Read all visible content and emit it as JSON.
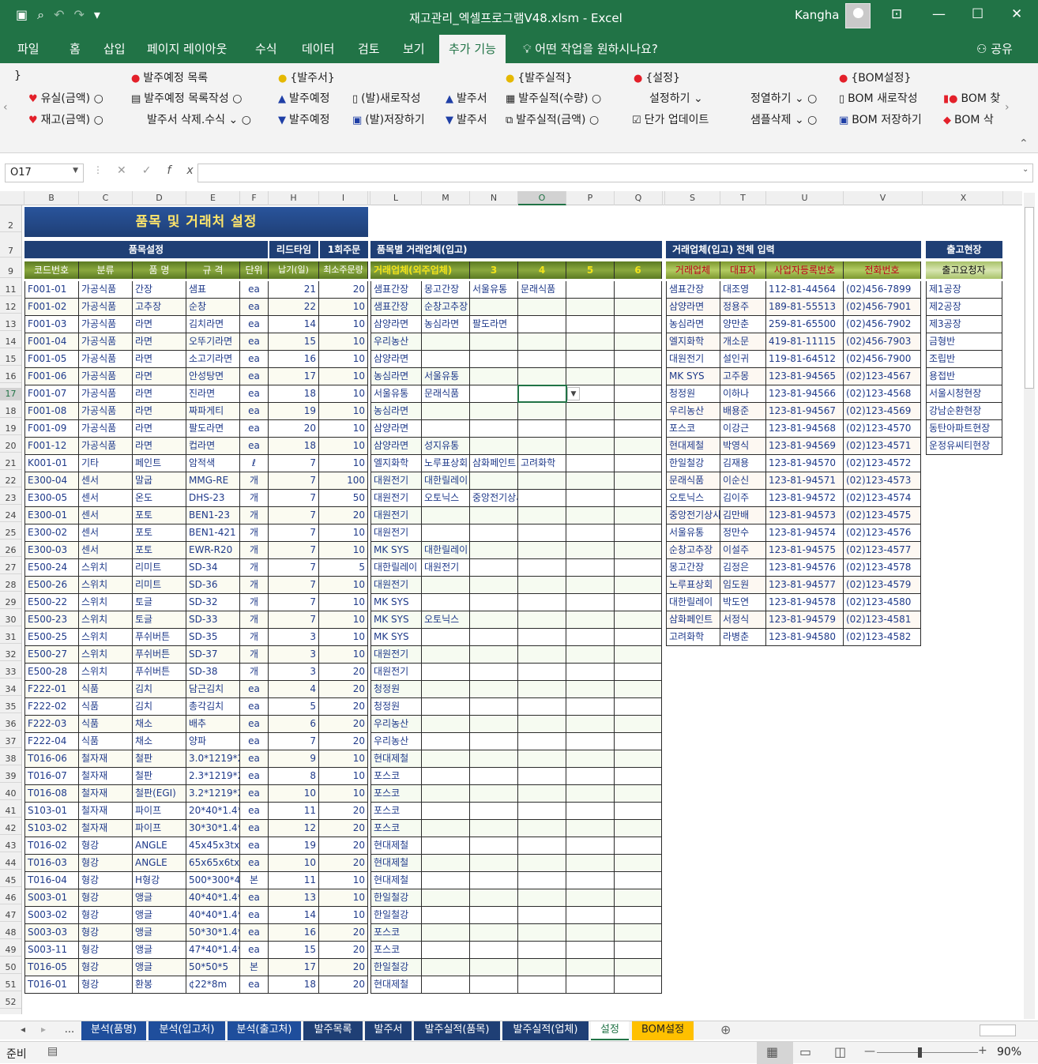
{
  "window": {
    "title": "재고관리_엑셀프로그램V48.xlsm  -  Excel",
    "user": "Kangha"
  },
  "tabs": [
    "파일",
    "홈",
    "삽입",
    "페이지 레이아웃",
    "수식",
    "데이터",
    "검토",
    "보기",
    "추가 기능"
  ],
  "active_tab": "추가 기능",
  "tellme": "어떤 작업을 원하시나요?",
  "share": "공유",
  "ribbon": {
    "g1": {
      "top": "}",
      "a": "유실(금액)",
      "b": "재고(금액)"
    },
    "g2": {
      "top": "발주예정 목록",
      "a": "발주예정 목록작성",
      "b": "발주서 삭제.수식"
    },
    "g3": {
      "top": "{발주서}",
      "a": "발주예정",
      "b": "발주예정",
      "c": "(발)새로작성",
      "d": "(발)저장하기",
      "e": "발주서",
      "f": "발주서"
    },
    "g4": {
      "top": "{발주실적}",
      "a": "발주실적(수량)",
      "b": "발주실적(금액)"
    },
    "g5": {
      "top": "{설정}",
      "a": "설정하기",
      "b": "단가 업데이트",
      "c": "정열하기",
      "d": "샘플삭제"
    },
    "g6": {
      "top": "{BOM설정}",
      "a": "BOM 새로작성",
      "b": "BOM 저장하기",
      "c": "BOM 찾",
      "d": "BOM 삭"
    }
  },
  "formula": {
    "name_box": "O17"
  },
  "columns": [
    "A",
    "B",
    "C",
    "D",
    "E",
    "F",
    "H",
    "I",
    "K",
    "L",
    "M",
    "N",
    "O",
    "P",
    "Q",
    "R",
    "S",
    "T",
    "U",
    "V",
    "X"
  ],
  "selected_col": "O",
  "rows": [
    "2",
    "7",
    "9",
    "11",
    "12",
    "13",
    "14",
    "15",
    "16",
    "17",
    "18",
    "19",
    "20",
    "21",
    "22",
    "23",
    "24",
    "25",
    "26",
    "27",
    "28",
    "29",
    "30",
    "31",
    "32",
    "33",
    "34",
    "35",
    "36",
    "37",
    "38",
    "39",
    "40",
    "41",
    "42",
    "43",
    "44",
    "45",
    "46",
    "47",
    "48",
    "49",
    "50",
    "51",
    "52"
  ],
  "selected_row": "17",
  "sheet": {
    "banner": "품목 및 거래처 설정",
    "sec1": "품목설정",
    "sec1b": "리드타임",
    "sec1c": "1회주문",
    "sec2": "품목별 거래업체(입고)",
    "sec3": "거래업체(입고) 전체 입력",
    "sec4": "출고현장",
    "hdr1": [
      "코드번호",
      "분류",
      "품 명",
      "규 격",
      "단위",
      "납기(일)",
      "최소주문량"
    ],
    "hdr2": [
      "거래업체(외주업체)",
      "3",
      "4",
      "5",
      "6"
    ],
    "hdr3": [
      "거래업체",
      "대표자",
      "사업자등록번호",
      "전화번호"
    ],
    "hdr4": "출고요청자",
    "items": [
      [
        "F001-01",
        "가공식품",
        "간장",
        "샘표",
        "ea",
        "21",
        "20"
      ],
      [
        "F001-02",
        "가공식품",
        "고추장",
        "순창",
        "ea",
        "22",
        "10"
      ],
      [
        "F001-03",
        "가공식품",
        "라면",
        "김치라면",
        "ea",
        "14",
        "10"
      ],
      [
        "F001-04",
        "가공식품",
        "라면",
        "오뚜기라면",
        "ea",
        "15",
        "10"
      ],
      [
        "F001-05",
        "가공식품",
        "라면",
        "소고기라면",
        "ea",
        "16",
        "10"
      ],
      [
        "F001-06",
        "가공식품",
        "라면",
        "안성탕면",
        "ea",
        "17",
        "10"
      ],
      [
        "F001-07",
        "가공식품",
        "라면",
        "진라면",
        "ea",
        "18",
        "10"
      ],
      [
        "F001-08",
        "가공식품",
        "라면",
        "짜파게티",
        "ea",
        "19",
        "10"
      ],
      [
        "F001-09",
        "가공식품",
        "라면",
        "팔도라면",
        "ea",
        "20",
        "10"
      ],
      [
        "F001-12",
        "가공식품",
        "라면",
        "컵라면",
        "ea",
        "18",
        "10"
      ],
      [
        "K001-01",
        "기타",
        "페인트",
        "암적색",
        "ℓ",
        "7",
        "10"
      ],
      [
        "E300-04",
        "센서",
        "말굽",
        "MMG-RE",
        "개",
        "7",
        "100"
      ],
      [
        "E300-05",
        "센서",
        "온도",
        "DHS-23",
        "개",
        "7",
        "50"
      ],
      [
        "E300-01",
        "센서",
        "포토",
        "BEN1-23",
        "개",
        "7",
        "20"
      ],
      [
        "E300-02",
        "센서",
        "포토",
        "BEN1-421",
        "개",
        "7",
        "10"
      ],
      [
        "E300-03",
        "센서",
        "포토",
        "EWR-R20",
        "개",
        "7",
        "10"
      ],
      [
        "E500-24",
        "스위치",
        "리미트",
        "SD-34",
        "개",
        "7",
        "5"
      ],
      [
        "E500-26",
        "스위치",
        "리미트",
        "SD-36",
        "개",
        "7",
        "10"
      ],
      [
        "E500-22",
        "스위치",
        "토글",
        "SD-32",
        "개",
        "7",
        "10"
      ],
      [
        "E500-23",
        "스위치",
        "토글",
        "SD-33",
        "개",
        "7",
        "10"
      ],
      [
        "E500-25",
        "스위치",
        "푸쉬버튼",
        "SD-35",
        "개",
        "3",
        "10"
      ],
      [
        "E500-27",
        "스위치",
        "푸쉬버튼",
        "SD-37",
        "개",
        "3",
        "10"
      ],
      [
        "E500-28",
        "스위치",
        "푸쉬버튼",
        "SD-38",
        "개",
        "3",
        "20"
      ],
      [
        "F222-01",
        "식품",
        "김치",
        "담근김치",
        "ea",
        "4",
        "20"
      ],
      [
        "F222-02",
        "식품",
        "김치",
        "총각김치",
        "ea",
        "5",
        "20"
      ],
      [
        "F222-03",
        "식품",
        "채소",
        "배추",
        "ea",
        "6",
        "20"
      ],
      [
        "F222-04",
        "식품",
        "채소",
        "양파",
        "ea",
        "7",
        "20"
      ],
      [
        "T016-06",
        "철자재",
        "철판",
        "3.0*1219*24",
        "ea",
        "9",
        "10"
      ],
      [
        "T016-07",
        "철자재",
        "철판",
        "2.3*1219*24",
        "ea",
        "8",
        "10"
      ],
      [
        "T016-08",
        "철자재",
        "철판(EGI)",
        "3.2*1219*24",
        "ea",
        "10",
        "10"
      ],
      [
        "S103-01",
        "철자재",
        "파이프",
        "20*40*1.4*6",
        "ea",
        "11",
        "20"
      ],
      [
        "S103-02",
        "철자재",
        "파이프",
        "30*30*1.4*6",
        "ea",
        "12",
        "20"
      ],
      [
        "T016-02",
        "형강",
        "ANGLE",
        "45x45x3tx6",
        "ea",
        "19",
        "20"
      ],
      [
        "T016-03",
        "형강",
        "ANGLE",
        "65x65x6tx1",
        "ea",
        "10",
        "20"
      ],
      [
        "T016-04",
        "형강",
        "H형강",
        "500*300*4*",
        "본",
        "11",
        "10"
      ],
      [
        "S003-01",
        "형강",
        "앵글",
        "40*40*1.4*1",
        "ea",
        "13",
        "10"
      ],
      [
        "S003-02",
        "형강",
        "앵글",
        "40*40*1.4*6",
        "ea",
        "14",
        "10"
      ],
      [
        "S003-03",
        "형강",
        "앵글",
        "50*30*1.4*6",
        "ea",
        "16",
        "20"
      ],
      [
        "S003-11",
        "형강",
        "앵글",
        "47*40*1.4*6",
        "ea",
        "15",
        "20"
      ],
      [
        "T016-05",
        "형강",
        "앵글",
        "50*50*5",
        "본",
        "17",
        "20"
      ],
      [
        "T016-01",
        "형강",
        "환봉",
        "¢22*8m",
        "ea",
        "18",
        "20"
      ]
    ],
    "vendors_by_item": [
      [
        "샘표간장",
        "몽고간장",
        "서울유통",
        "문래식품"
      ],
      [
        "샘표간장",
        "순창고추장",
        "",
        ""
      ],
      [
        "삼양라면",
        "농심라면",
        "팔도라면",
        ""
      ],
      [
        "우리농산",
        "",
        "",
        ""
      ],
      [
        "삼양라면",
        "",
        "",
        ""
      ],
      [
        "농심라면",
        "서울유통",
        "",
        ""
      ],
      [
        "서울유통",
        "문래식품",
        "",
        ""
      ],
      [
        "농심라면",
        "",
        "",
        ""
      ],
      [
        "삼양라면",
        "",
        "",
        ""
      ],
      [
        "삼양라면",
        "성지유통",
        "",
        ""
      ],
      [
        "엘지화학",
        "노루표상회",
        "삼화페인트",
        "고려화학"
      ],
      [
        "대원전기",
        "대한릴레이",
        "",
        ""
      ],
      [
        "대원전기",
        "오토닉스",
        "중앙전기상사",
        ""
      ],
      [
        "대원전기",
        "",
        "",
        ""
      ],
      [
        "대원전기",
        "",
        "",
        ""
      ],
      [
        "MK SYS",
        "대한릴레이",
        "",
        ""
      ],
      [
        "대한릴레이",
        "대원전기",
        "",
        ""
      ],
      [
        "대원전기",
        "",
        "",
        ""
      ],
      [
        "MK SYS",
        "",
        "",
        ""
      ],
      [
        "MK SYS",
        "오토닉스",
        "",
        ""
      ],
      [
        "MK SYS",
        "",
        "",
        ""
      ],
      [
        "대원전기",
        "",
        "",
        ""
      ],
      [
        "대원전기",
        "",
        "",
        ""
      ],
      [
        "청정원",
        "",
        "",
        ""
      ],
      [
        "청정원",
        "",
        "",
        ""
      ],
      [
        "우리농산",
        "",
        "",
        ""
      ],
      [
        "우리농산",
        "",
        "",
        ""
      ],
      [
        "현대제철",
        "",
        "",
        ""
      ],
      [
        "포스코",
        "",
        "",
        ""
      ],
      [
        "포스코",
        "",
        "",
        ""
      ],
      [
        "포스코",
        "",
        "",
        ""
      ],
      [
        "포스코",
        "",
        "",
        ""
      ],
      [
        "현대제철",
        "",
        "",
        ""
      ],
      [
        "현대제철",
        "",
        "",
        ""
      ],
      [
        "현대제철",
        "",
        "",
        ""
      ],
      [
        "한일철강",
        "",
        "",
        ""
      ],
      [
        "한일철강",
        "",
        "",
        ""
      ],
      [
        "포스코",
        "",
        "",
        ""
      ],
      [
        "포스코",
        "",
        "",
        ""
      ],
      [
        "한일철강",
        "",
        "",
        ""
      ],
      [
        "현대제철",
        "",
        "",
        ""
      ]
    ],
    "vendors": [
      [
        "샘표간장",
        "대조영",
        "112-81-44564",
        "(02)456-7899"
      ],
      [
        "삼양라면",
        "정용주",
        "189-81-55513",
        "(02)456-7901"
      ],
      [
        "농심라면",
        "양만춘",
        "259-81-65500",
        "(02)456-7902"
      ],
      [
        "엘지화학",
        "개소문",
        "419-81-11115",
        "(02)456-7903"
      ],
      [
        "대원전기",
        "설인귀",
        "119-81-64512",
        "(02)456-7900"
      ],
      [
        "MK SYS",
        "고주몽",
        "123-81-94565",
        "(02)123-4567"
      ],
      [
        "청정원",
        "이하나",
        "123-81-94566",
        "(02)123-4568"
      ],
      [
        "우리농산",
        "배용준",
        "123-81-94567",
        "(02)123-4569"
      ],
      [
        "포스코",
        "이강근",
        "123-81-94568",
        "(02)123-4570"
      ],
      [
        "현대제철",
        "박영식",
        "123-81-94569",
        "(02)123-4571"
      ],
      [
        "한일철강",
        "김재용",
        "123-81-94570",
        "(02)123-4572"
      ],
      [
        "문래식품",
        "이순신",
        "123-81-94571",
        "(02)123-4573"
      ],
      [
        "오토닉스",
        "김이주",
        "123-81-94572",
        "(02)123-4574"
      ],
      [
        "중앙전기상사",
        "김만배",
        "123-81-94573",
        "(02)123-4575"
      ],
      [
        "서울유통",
        "정만수",
        "123-81-94574",
        "(02)123-4576"
      ],
      [
        "순창고추장",
        "이설주",
        "123-81-94575",
        "(02)123-4577"
      ],
      [
        "몽고간장",
        "김정은",
        "123-81-94576",
        "(02)123-4578"
      ],
      [
        "노루표상회",
        "임도원",
        "123-81-94577",
        "(02)123-4579"
      ],
      [
        "대한릴레이",
        "박도연",
        "123-81-94578",
        "(02)123-4580"
      ],
      [
        "삼화페인트",
        "서정식",
        "123-81-94579",
        "(02)123-4581"
      ],
      [
        "고려화학",
        "라병춘",
        "123-81-94580",
        "(02)123-4582"
      ]
    ],
    "sites": [
      "제1공장",
      "제2공장",
      "제3공장",
      "금형반",
      "조립반",
      "용접반",
      "서울시청현장",
      "강남순환현장",
      "동탄아파트현장",
      "운정유씨티현장"
    ]
  },
  "sheet_tabs": [
    "...",
    "분석(품명)",
    "분석(입고처)",
    "분석(출고처)",
    "발주목록",
    "발주서",
    "발주실적(품목)",
    "발주실적(업체)",
    "설정",
    "BOM설정"
  ],
  "status": {
    "ready": "준비",
    "zoom": "90%"
  },
  "colors": {
    "excel_green": "#217346",
    "header_navy": "#1f3f75",
    "header_olive": "#8aa83e",
    "banner_text": "#ffe56b"
  }
}
